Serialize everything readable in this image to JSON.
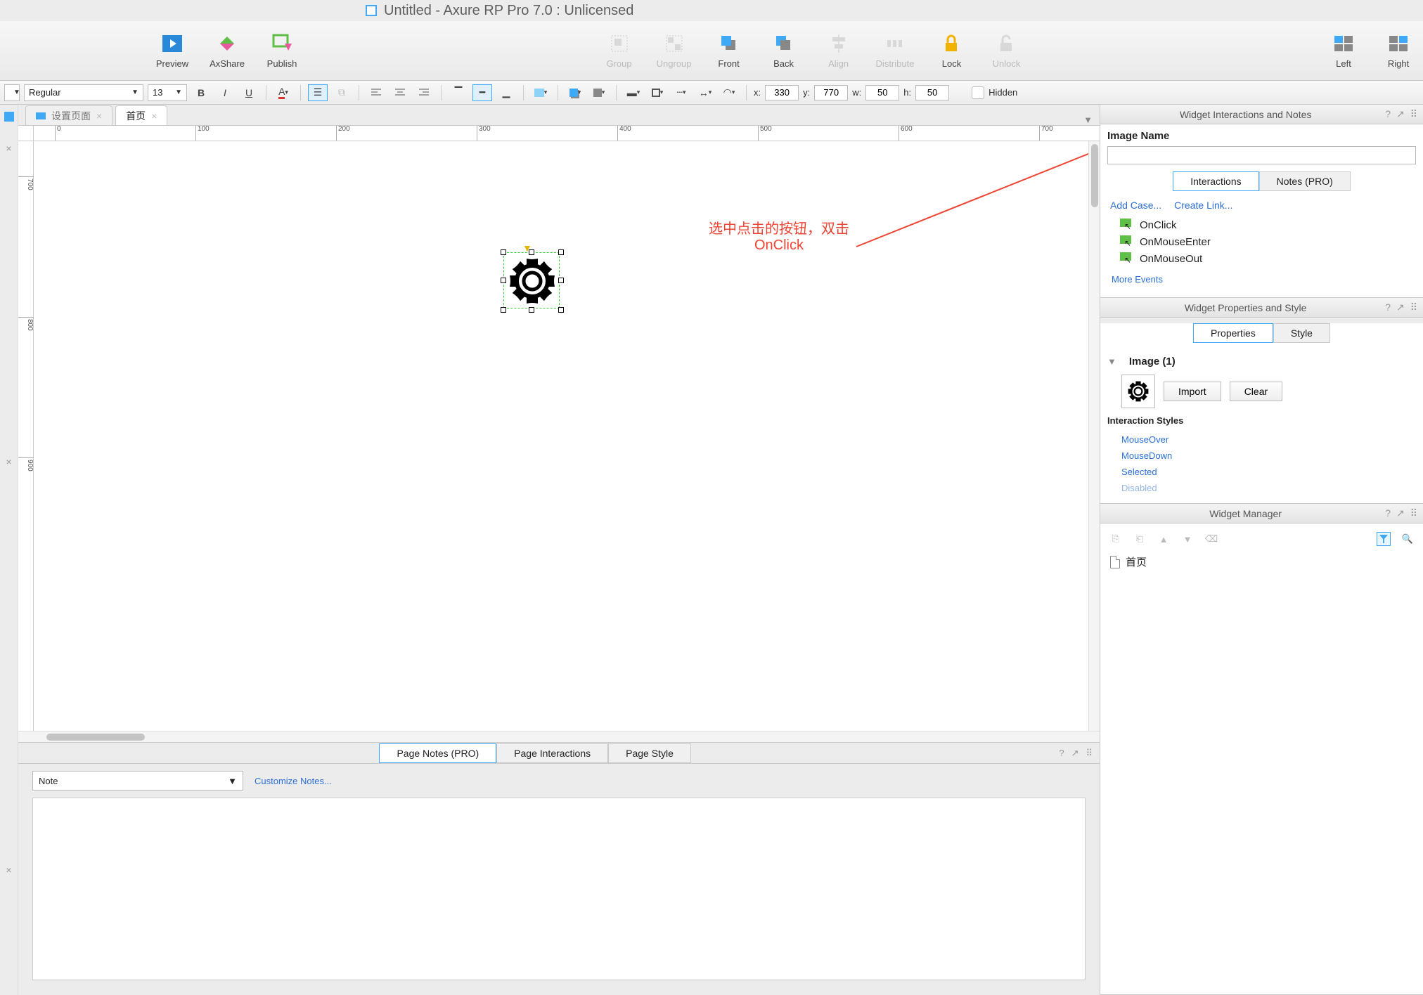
{
  "title": "Untitled - Axure RP Pro 7.0 : Unlicensed",
  "main_toolbar": {
    "preview": "Preview",
    "axshare": "AxShare",
    "publish": "Publish",
    "group": "Group",
    "ungroup": "Ungroup",
    "front": "Front",
    "back": "Back",
    "align": "Align",
    "distribute": "Distribute",
    "lock": "Lock",
    "unlock": "Unlock",
    "left": "Left",
    "right": "Right"
  },
  "sub": {
    "weight": "Regular",
    "size": "13",
    "x_lbl": "x:",
    "x": "330",
    "y_lbl": "y:",
    "y": "770",
    "w_lbl": "w:",
    "w": "50",
    "h_lbl": "h:",
    "h": "50",
    "hidden": "Hidden"
  },
  "tabs": {
    "settings": "设置页面",
    "home": "首页"
  },
  "ruler": {
    "h": [
      "0",
      "100",
      "200",
      "300",
      "400",
      "500",
      "600",
      "700"
    ],
    "v": [
      "700",
      "800",
      "900"
    ]
  },
  "annotation": {
    "line1": "选中点击的按钮，双击",
    "line2": "OnClick"
  },
  "bottom": {
    "page_notes": "Page Notes (PRO)",
    "page_interactions": "Page Interactions",
    "page_style": "Page Style",
    "note": "Note",
    "customize": "Customize Notes..."
  },
  "right": {
    "interactions_panel": "Widget Interactions and Notes",
    "image_name": "Image Name",
    "tab_interactions": "Interactions",
    "tab_notes": "Notes (PRO)",
    "add_case": "Add Case...",
    "create_link": "Create Link...",
    "events": [
      "OnClick",
      "OnMouseEnter",
      "OnMouseOut"
    ],
    "more_events": "More Events",
    "props_panel": "Widget Properties and Style",
    "tab_properties": "Properties",
    "tab_style": "Style",
    "image_hdr": "Image (1)",
    "import": "Import",
    "clear": "Clear",
    "int_styles": "Interaction Styles",
    "styles": [
      "MouseOver",
      "MouseDown",
      "Selected",
      "Disabled"
    ],
    "mgr_panel": "Widget Manager",
    "mgr_item": "首页"
  }
}
